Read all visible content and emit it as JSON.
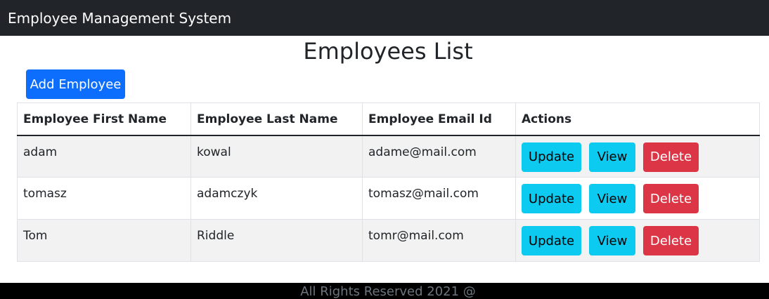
{
  "navbar": {
    "brand": "Employee Management System"
  },
  "page": {
    "title": "Employees List",
    "add_button": "Add Employee"
  },
  "table": {
    "headers": [
      "Employee First Name",
      "Employee Last Name",
      "Employee Email Id",
      "Actions"
    ],
    "rows": [
      {
        "first_name": "adam",
        "last_name": "kowal",
        "email": "adame@mail.com"
      },
      {
        "first_name": "tomasz",
        "last_name": "adamczyk",
        "email": "tomasz@mail.com"
      },
      {
        "first_name": "Tom",
        "last_name": "Riddle",
        "email": "tomr@mail.com"
      }
    ],
    "actions": {
      "update": "Update",
      "view": "View",
      "delete": "Delete"
    }
  },
  "footer": {
    "text": "All Rights Reserved 2021 @"
  },
  "colors": {
    "navbar": "#212529",
    "primary": "#0d6efd",
    "info": "#0dcaf0",
    "danger": "#dc3545",
    "stripe": "#f2f2f2"
  }
}
